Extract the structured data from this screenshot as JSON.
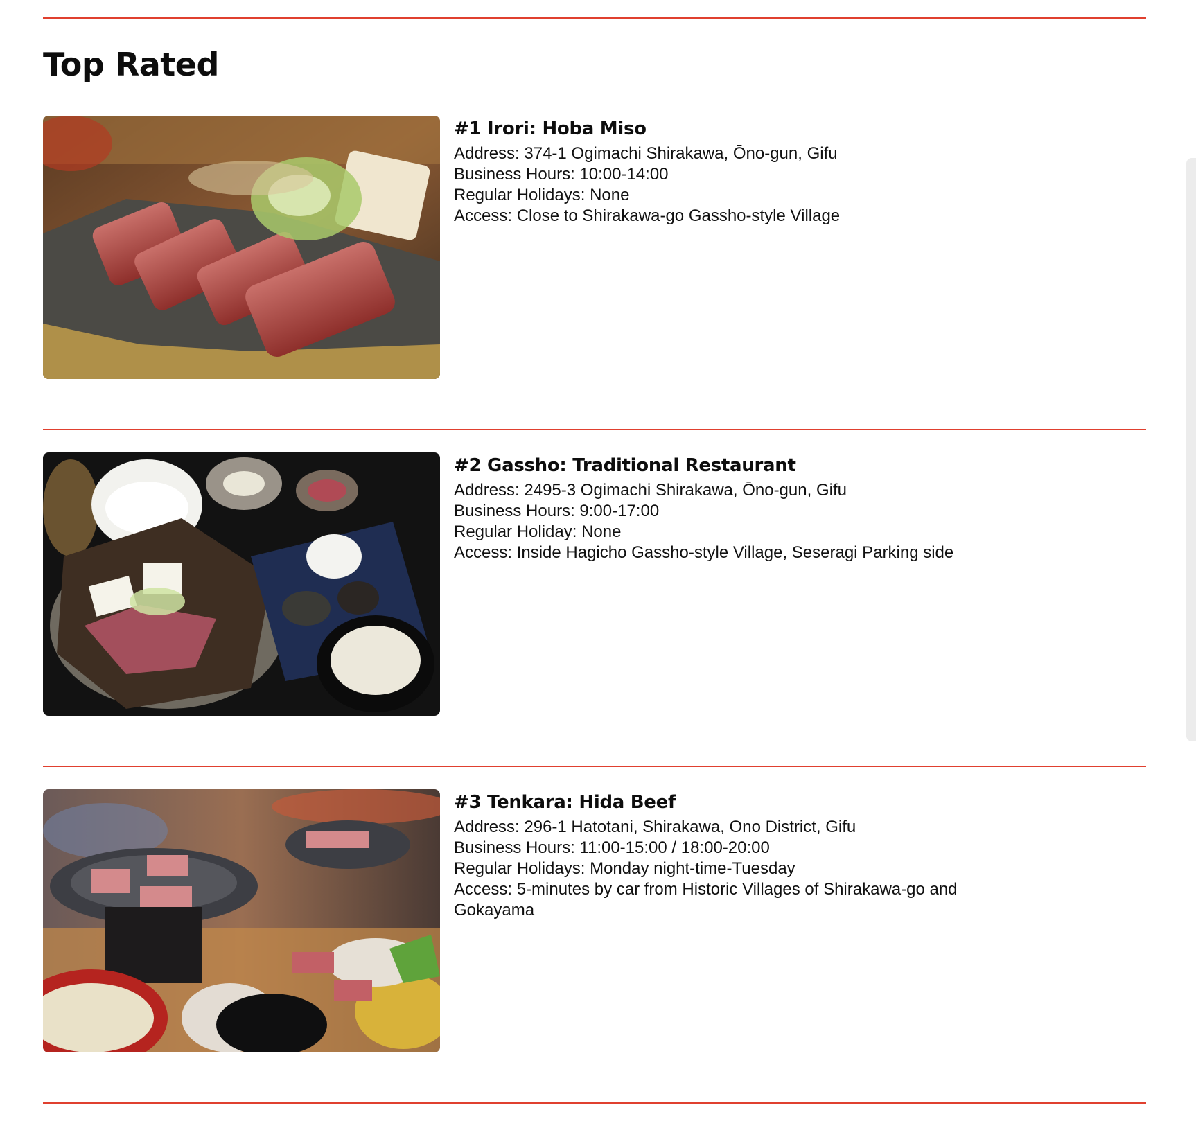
{
  "section": {
    "title": "Top Rated"
  },
  "colors": {
    "accent_rule": "#e0402f",
    "text": "#111111"
  },
  "entries": [
    {
      "heading": "#1 Irori: Hoba Miso",
      "address": "Address: 374-1 Ogimachi Shirakawa, Ōno-gun, Gifu",
      "hours": "Business Hours: 10:00-14:00",
      "holidays": "Regular Holidays: None",
      "access": "Access: Close to Shirakawa-go Gassho-style Village",
      "image": "hoba-miso-beef-photo"
    },
    {
      "heading": "#2 Gassho: Traditional Restaurant",
      "address": "Address: 2495-3 Ogimachi Shirakawa, Ōno-gun, Gifu",
      "hours": "Business Hours: 9:00-17:00",
      "holidays": "Regular Holiday: None",
      "access": "Access: Inside Hagicho Gassho-style Village, Seseragi Parking side",
      "image": "traditional-set-meal-photo"
    },
    {
      "heading": "#3 Tenkara: Hida Beef",
      "address": "Address: 296-1 Hatotani, Shirakawa, Ono District, Gifu",
      "hours": "Business Hours: 11:00-15:00 / 18:00-20:00",
      "holidays": "Regular Holidays: Monday night-time-Tuesday",
      "access": "Access: 5-minutes by car from Historic Villages of Shirakawa-go and Gokayama",
      "image": "hida-beef-grill-photo"
    }
  ]
}
